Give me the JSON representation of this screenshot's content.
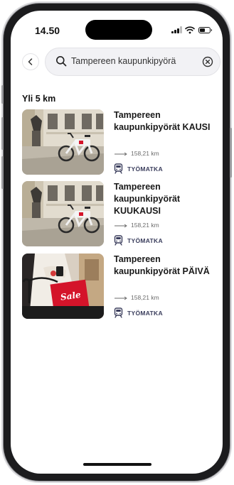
{
  "status_bar": {
    "time": "14.50",
    "battery_level": 0.55
  },
  "search": {
    "query": "Tampereen kaupunkipyörä"
  },
  "section": {
    "title": "Yli 5 km"
  },
  "results": [
    {
      "title": "Tampereen kaupunkipyörät KAUSI",
      "distance": "158,21 km",
      "tag": "TYÖMATKA",
      "image": "city-bike-photo"
    },
    {
      "title": "Tampereen kaupunkipyörät KUUKAUSI",
      "distance": "158,21 km",
      "tag": "TYÖMATKA",
      "image": "city-bike-photo"
    },
    {
      "title": "Tampereen kaupunkipyörät PÄIVÄ",
      "distance": "158,21 km",
      "tag": "TYÖMATKA",
      "image": "sale-bag-photo",
      "image_text": "Sale"
    }
  ],
  "icons": {
    "back": "chevron-left-icon",
    "search": "search-icon",
    "clear": "close-circle-icon",
    "distance": "distance-arrow-icon",
    "tag": "train-icon"
  },
  "colors": {
    "accent": "#3a3d5c",
    "sale_red": "#e01a2b"
  }
}
